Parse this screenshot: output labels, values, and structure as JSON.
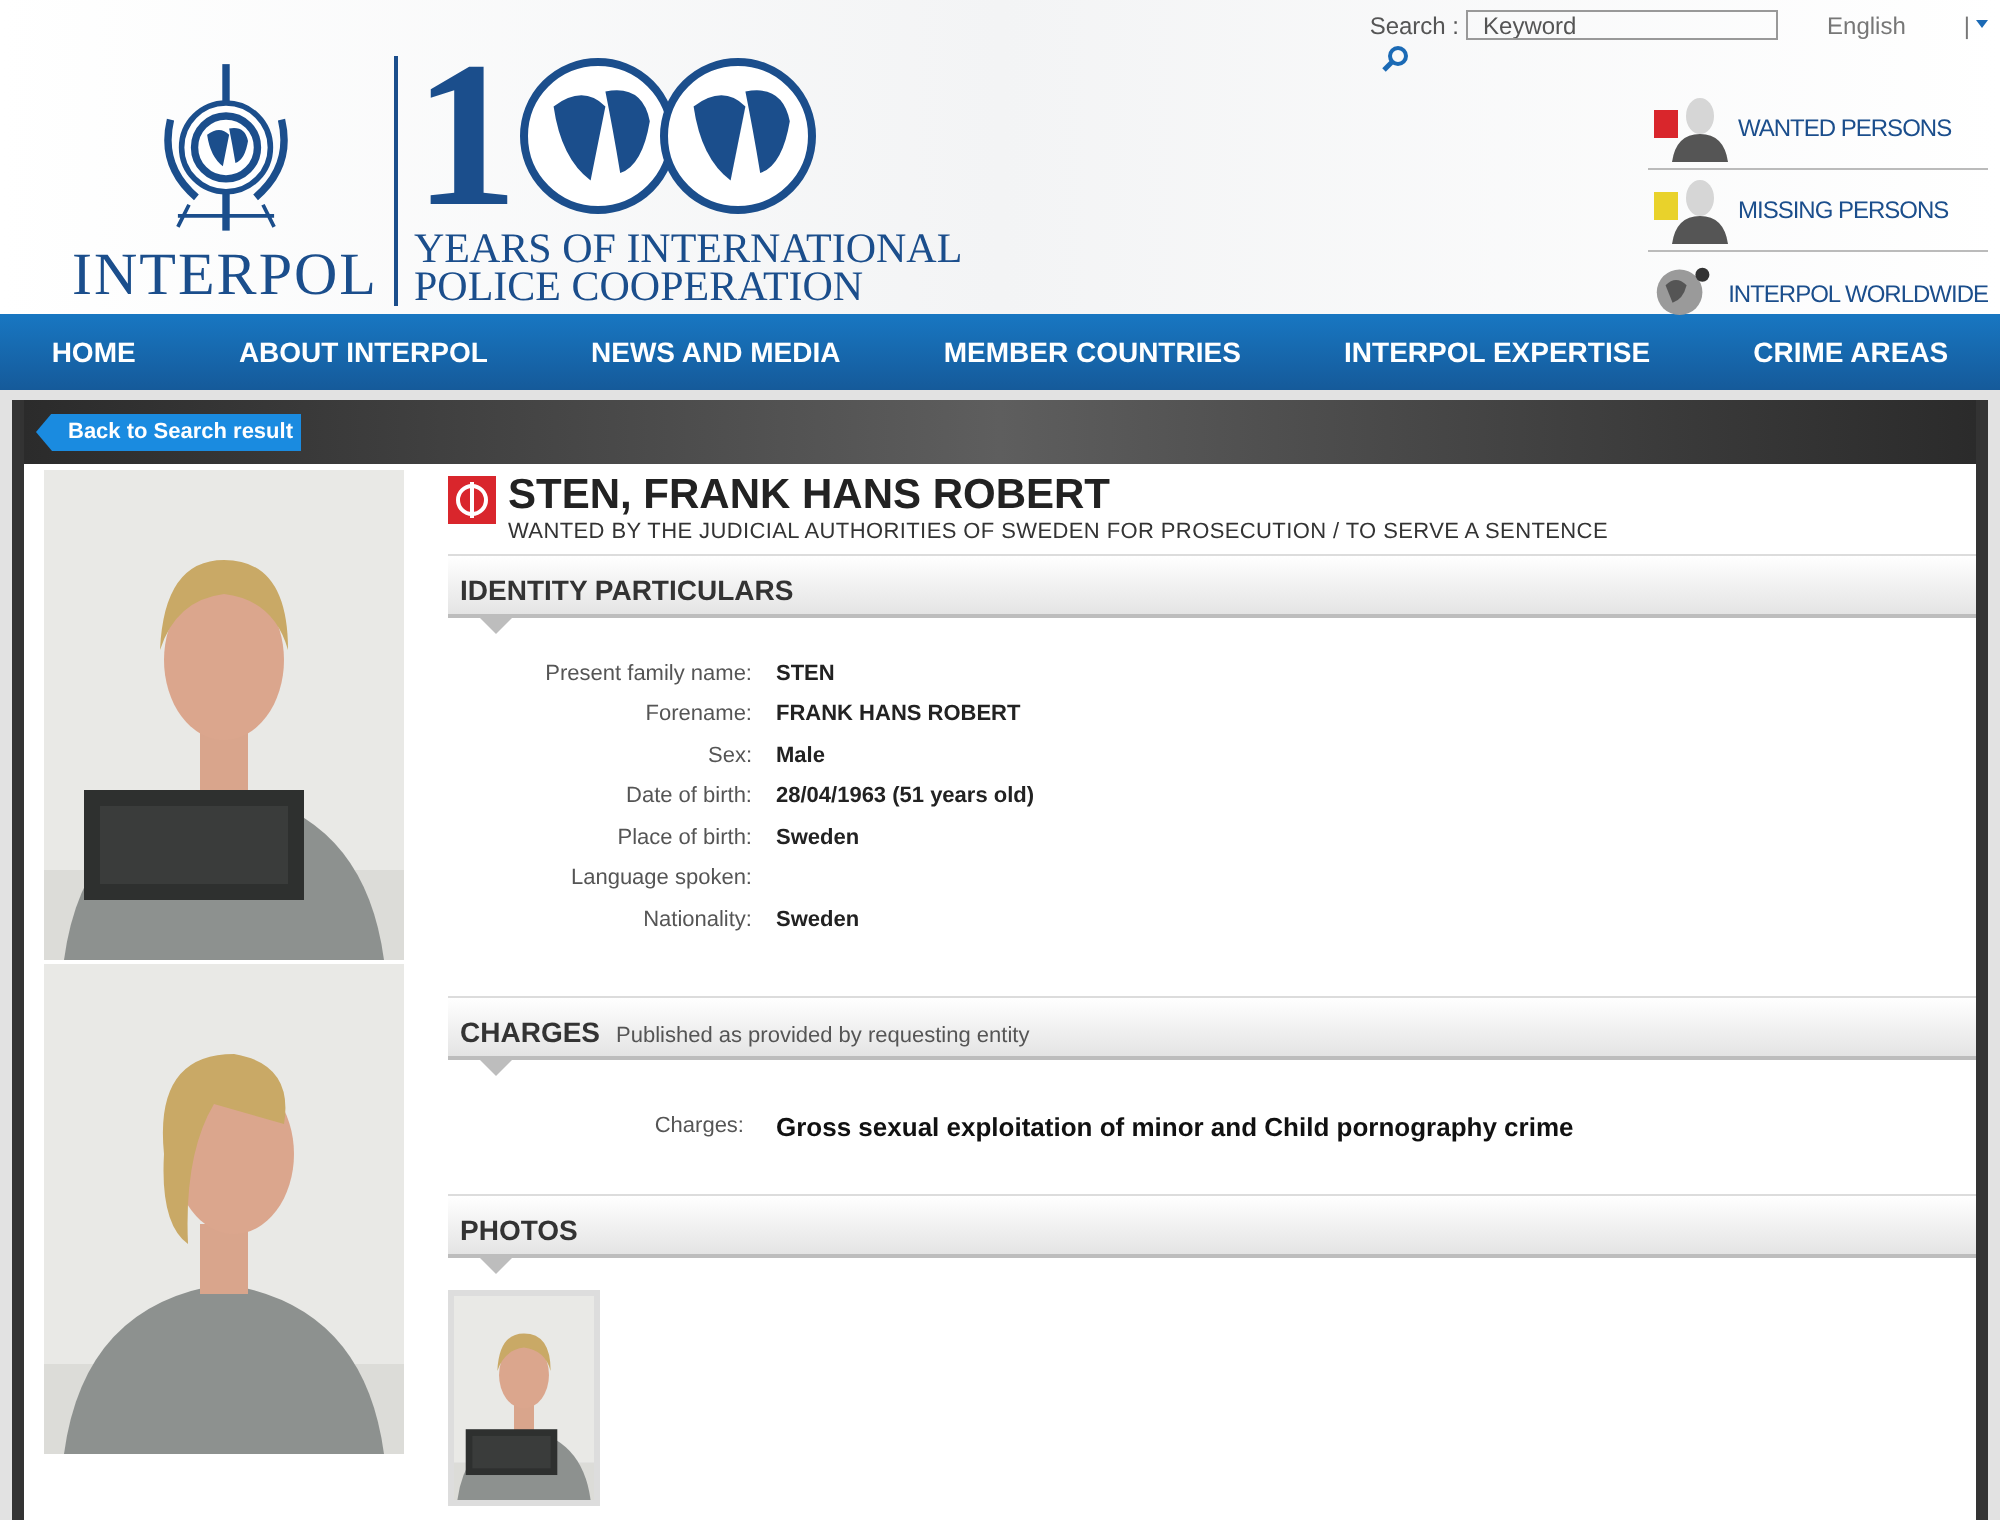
{
  "header": {
    "logo": {
      "name": "INTERPOL",
      "digit": "1",
      "tagline_1": "YEARS OF INTERNATIONAL",
      "tagline_2": "POLICE COOPERATION"
    },
    "search": {
      "label": "Search :",
      "placeholder": "Keyword"
    },
    "language": {
      "label": "English",
      "separator": "|"
    },
    "quick_links": [
      {
        "label": "WANTED PERSONS",
        "kind": "wanted"
      },
      {
        "label": "MISSING PERSONS",
        "kind": "missing"
      },
      {
        "label": "INTERPOL WORLDWIDE",
        "kind": "world"
      }
    ]
  },
  "nav": [
    "HOME",
    "ABOUT INTERPOL",
    "NEWS AND MEDIA",
    "MEMBER COUNTRIES",
    "INTERPOL EXPERTISE",
    "CRIME AREAS"
  ],
  "back_button": "Back to Search result",
  "notice": {
    "name": "STEN, FRANK HANS ROBERT",
    "subtitle": "WANTED BY THE JUDICIAL AUTHORITIES OF SWEDEN FOR PROSECUTION / TO SERVE A SENTENCE"
  },
  "identity": {
    "title": "IDENTITY PARTICULARS",
    "fields": [
      {
        "label": "Present family name:",
        "value": "STEN"
      },
      {
        "label": "Forename:",
        "value": "FRANK HANS ROBERT"
      },
      {
        "label": "Sex:",
        "value": "Male"
      },
      {
        "label": "Date of birth:",
        "value": "28/04/1963 (51 years old)"
      },
      {
        "label": "Place of birth:",
        "value": "Sweden"
      },
      {
        "label": "Language spoken:"
      },
      {
        "label": "Nationality:",
        "value": "Sweden"
      }
    ]
  },
  "charges": {
    "title": "CHARGES",
    "note": "Published as provided by requesting entity",
    "label": "Charges:",
    "value": "Gross sexual exploitation of minor and Child pornography crime"
  },
  "photos": {
    "title": "PHOTOS",
    "thumbnails": [
      {
        "kind": "picture"
      }
    ]
  },
  "side_photos": [
    {
      "kind": "picture"
    },
    {
      "kind": "picture"
    }
  ]
}
